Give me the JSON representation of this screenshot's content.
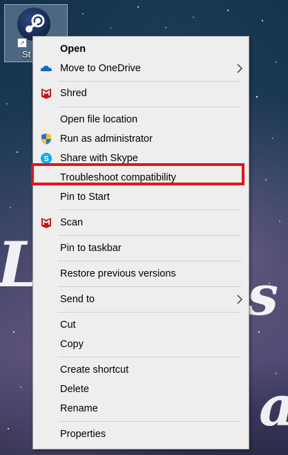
{
  "desktop_icon": {
    "label": "St"
  },
  "menu": {
    "items": [
      {
        "label": "Open"
      },
      {
        "label": "Move to OneDrive"
      },
      {
        "label": "Shred"
      },
      {
        "label": "Open file location"
      },
      {
        "label": "Run as administrator"
      },
      {
        "label": "Share with Skype"
      },
      {
        "label": "Troubleshoot compatibility"
      },
      {
        "label": "Pin to Start"
      },
      {
        "label": "Scan"
      },
      {
        "label": "Pin to taskbar"
      },
      {
        "label": "Restore previous versions"
      },
      {
        "label": "Send to"
      },
      {
        "label": "Cut"
      },
      {
        "label": "Copy"
      },
      {
        "label": "Create shortcut"
      },
      {
        "label": "Delete"
      },
      {
        "label": "Rename"
      },
      {
        "label": "Properties"
      }
    ]
  },
  "icons": {
    "onedrive": "onedrive-icon",
    "mcafee": "mcafee-icon",
    "shield": "uac-shield-icon",
    "skype": "skype-icon",
    "chevron": "chevron-right-icon"
  },
  "colors": {
    "menu_bg": "#eeeeee",
    "highlight_border": "#e4141b",
    "onedrive": "#0f6cbd",
    "mcafee": "#c01818",
    "skype": "#00aff0"
  }
}
